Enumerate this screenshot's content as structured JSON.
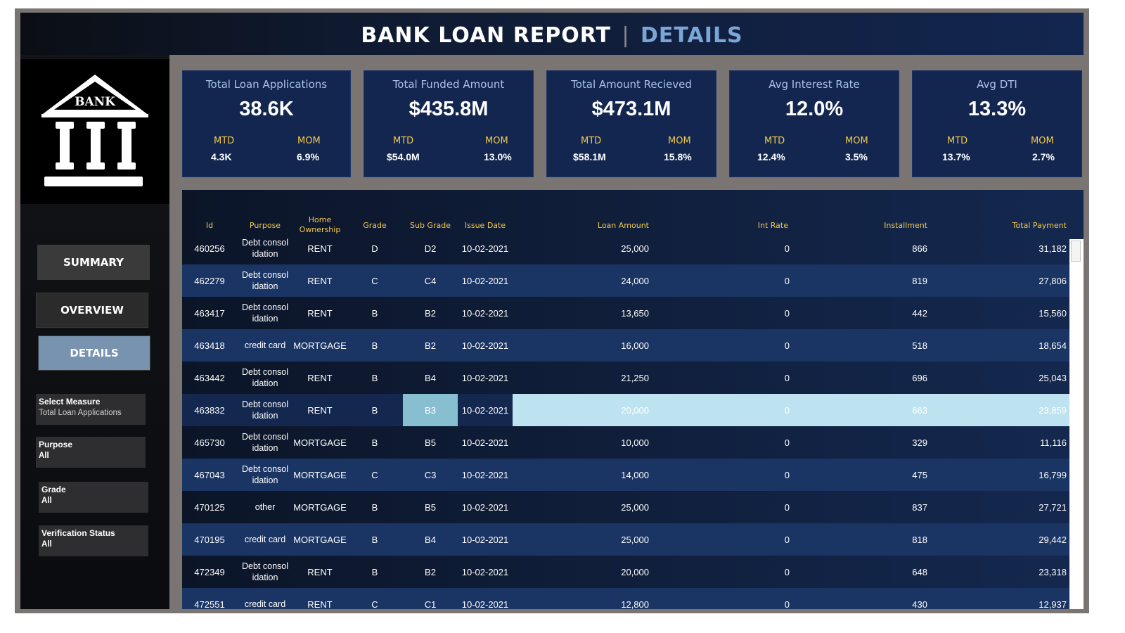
{
  "header": {
    "title_main": "BANK LOAN REPORT",
    "separator": "|",
    "title_sub": "DETAILS"
  },
  "logo": {
    "text": "BANK",
    "icon": "bank-building-icon"
  },
  "nav": {
    "summary": "SUMMARY",
    "overview": "OVERVIEW",
    "details": "DETAILS",
    "active": "DETAILS"
  },
  "filters": {
    "measure": {
      "label": "Select Measure",
      "value": "Total Loan Applications"
    },
    "purpose": {
      "label": "Purpose",
      "value": "All"
    },
    "grade": {
      "label": "Grade",
      "value": "All"
    },
    "verification": {
      "label": "Verification Status",
      "value": "All"
    }
  },
  "kpis": [
    {
      "title": "Total Loan Applications",
      "value": "38.6K",
      "mtd_label": "MTD",
      "mtd": "4.3K",
      "mom_label": "MOM",
      "mom": "6.9%"
    },
    {
      "title": "Total Funded Amount",
      "value": "$435.8M",
      "mtd_label": "MTD",
      "mtd": "$54.0M",
      "mom_label": "MOM",
      "mom": "13.0%"
    },
    {
      "title": "Total Amount Recieved",
      "value": "$473.1M",
      "mtd_label": "MTD",
      "mtd": "$58.1M",
      "mom_label": "MOM",
      "mom": "15.8%"
    },
    {
      "title": "Avg Interest Rate",
      "value": "12.0%",
      "mtd_label": "MTD",
      "mtd": "12.4%",
      "mom_label": "MOM",
      "mom": "3.5%"
    },
    {
      "title": "Avg DTI",
      "value": "13.3%",
      "mtd_label": "MTD",
      "mtd": "13.7%",
      "mom_label": "MOM",
      "mom": "2.7%"
    }
  ],
  "table": {
    "headers": {
      "id": "Id",
      "purpose": "Purpose",
      "home": "Home Ownership",
      "grade": "Grade",
      "sub": "Sub Grade",
      "date": "Issue Date",
      "loan": "Loan Amount",
      "int": "Int Rate",
      "inst": "Installment",
      "total": "Total Payment"
    },
    "rows": [
      {
        "id": "460256",
        "purpose": "Debt consol idation",
        "home": "RENT",
        "grade": "D",
        "sub": "D2",
        "date": "10-02-2021",
        "loan": "25,000",
        "int": "0",
        "inst": "866",
        "total": "31,182"
      },
      {
        "id": "462279",
        "purpose": "Debt consol idation",
        "home": "RENT",
        "grade": "C",
        "sub": "C4",
        "date": "10-02-2021",
        "loan": "24,000",
        "int": "0",
        "inst": "819",
        "total": "27,806"
      },
      {
        "id": "463417",
        "purpose": "Debt consol idation",
        "home": "RENT",
        "grade": "B",
        "sub": "B2",
        "date": "10-02-2021",
        "loan": "13,650",
        "int": "0",
        "inst": "442",
        "total": "15,560"
      },
      {
        "id": "463418",
        "purpose": "credit card",
        "home": "MORTGAGE",
        "grade": "B",
        "sub": "B2",
        "date": "10-02-2021",
        "loan": "16,000",
        "int": "0",
        "inst": "518",
        "total": "18,654"
      },
      {
        "id": "463442",
        "purpose": "Debt consol idation",
        "home": "RENT",
        "grade": "B",
        "sub": "B4",
        "date": "10-02-2021",
        "loan": "21,250",
        "int": "0",
        "inst": "696",
        "total": "25,043"
      },
      {
        "id": "463832",
        "purpose": "Debt consol idation",
        "home": "RENT",
        "grade": "B",
        "sub": "B3",
        "date": "10-02-2021",
        "loan": "20,000",
        "int": "0",
        "inst": "663",
        "total": "23,859"
      },
      {
        "id": "465730",
        "purpose": "Debt consol idation",
        "home": "MORTGAGE",
        "grade": "B",
        "sub": "B5",
        "date": "10-02-2021",
        "loan": "10,000",
        "int": "0",
        "inst": "329",
        "total": "11,116"
      },
      {
        "id": "467043",
        "purpose": "Debt consol idation",
        "home": "MORTGAGE",
        "grade": "C",
        "sub": "C3",
        "date": "10-02-2021",
        "loan": "14,000",
        "int": "0",
        "inst": "475",
        "total": "16,799"
      },
      {
        "id": "470125",
        "purpose": "other",
        "home": "MORTGAGE",
        "grade": "B",
        "sub": "B5",
        "date": "10-02-2021",
        "loan": "25,000",
        "int": "0",
        "inst": "837",
        "total": "27,721"
      },
      {
        "id": "470195",
        "purpose": "credit card",
        "home": "MORTGAGE",
        "grade": "B",
        "sub": "B4",
        "date": "10-02-2021",
        "loan": "25,000",
        "int": "0",
        "inst": "818",
        "total": "29,442"
      },
      {
        "id": "472349",
        "purpose": "Debt consol idation",
        "home": "RENT",
        "grade": "B",
        "sub": "B2",
        "date": "10-02-2021",
        "loan": "20,000",
        "int": "0",
        "inst": "648",
        "total": "23,318"
      },
      {
        "id": "472551",
        "purpose": "credit card",
        "home": "RENT",
        "grade": "C",
        "sub": "C1",
        "date": "10-02-2021",
        "loan": "12,800",
        "int": "0",
        "inst": "430",
        "total": "12,937"
      }
    ],
    "highlighted_row_id": "463832"
  },
  "colors": {
    "header_accent": "#7aa6d6",
    "kpi_bg": "#13264f",
    "kpi_label": "#f2c94c",
    "highlight_row": "#bde3f0",
    "details_button": "#7893b0"
  }
}
